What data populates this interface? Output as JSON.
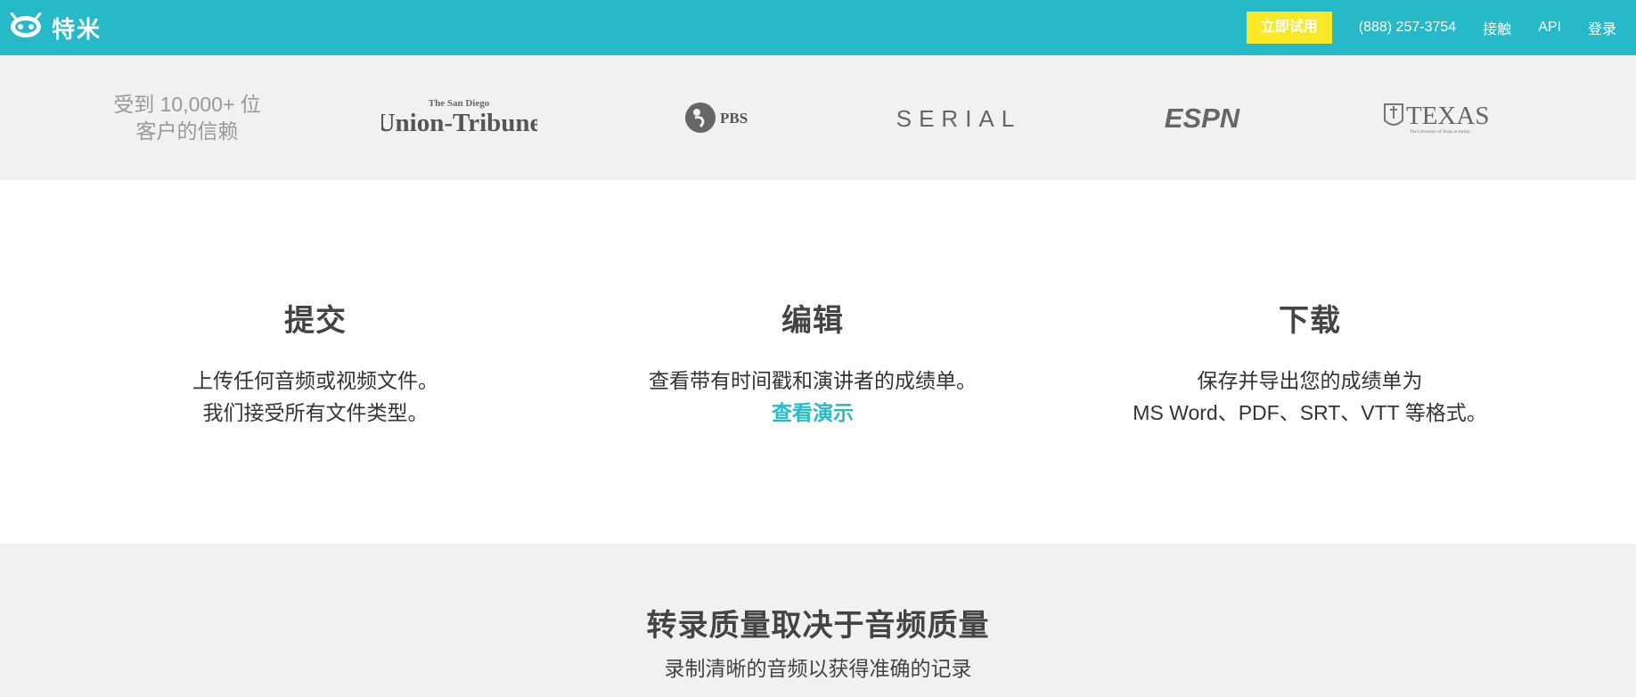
{
  "header": {
    "brand": "特米",
    "cta_label": "立即试用",
    "phone": "(888) 257-3754",
    "nav": [
      "接触",
      "API",
      "登录"
    ]
  },
  "trust": {
    "line1": "受到 10,000+ 位",
    "line2": "客户的信赖",
    "logos": [
      {
        "icon": "union-tribune-logo",
        "top": "The San Diego",
        "main": "Union-Tribune"
      },
      {
        "icon": "pbs-logo",
        "main": "PBS"
      },
      {
        "icon": "serial-logo",
        "main": "SERIAL"
      },
      {
        "icon": "espn-logo",
        "main": "ESPN"
      },
      {
        "icon": "texas-logo",
        "main": "TEXAS",
        "sub": "The University of Texas at Austin"
      }
    ]
  },
  "steps": [
    {
      "title": "提交",
      "line1": "上传任何音频或视频文件。",
      "line2": "我们接受所有文件类型。"
    },
    {
      "title": "编辑",
      "line1": "查看带有时间戳和演讲者的成绩单。",
      "link": "查看演示"
    },
    {
      "title": "下载",
      "line1": "保存并导出您的成绩单为",
      "line2": "MS Word、PDF、SRT、VTT 等格式。"
    }
  ],
  "quality": {
    "title": "转录质量取决于音频质量",
    "subtitle": "录制清晰的音频以获得准确的记录"
  },
  "colors": {
    "brand": "#26b9c7",
    "cta": "#f8e825",
    "band": "#f1f1f1"
  }
}
